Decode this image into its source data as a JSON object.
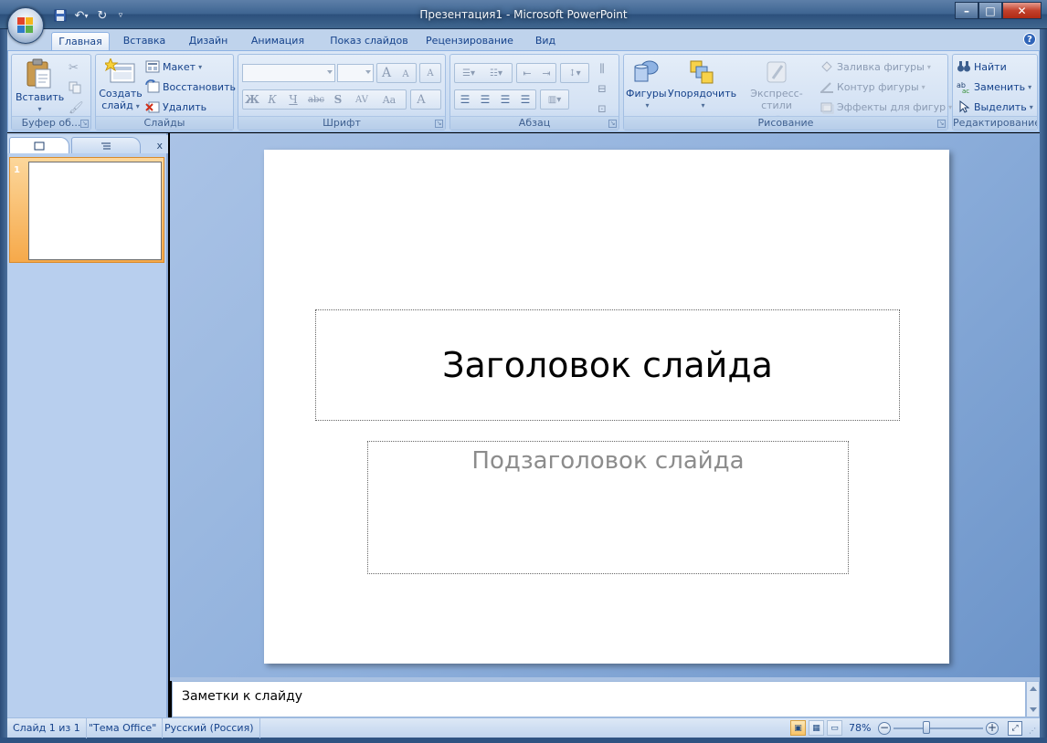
{
  "window": {
    "title": "Презентация1 - Microsoft PowerPoint",
    "controls": {
      "minimize": "–",
      "maximize": "□",
      "close": "✕"
    }
  },
  "qat": {
    "save_icon": "save-icon",
    "undo_icon": "undo-icon",
    "redo_icon": "redo-icon",
    "customize_icon": "customize-icon"
  },
  "tabs": [
    {
      "label": "Главная",
      "active": true
    },
    {
      "label": "Вставка"
    },
    {
      "label": "Дизайн"
    },
    {
      "label": "Анимация"
    },
    {
      "label": "Показ слайдов"
    },
    {
      "label": "Рецензирование"
    },
    {
      "label": "Вид"
    }
  ],
  "ribbon": {
    "clipboard": {
      "label": "Буфер об...",
      "paste": "Вставить"
    },
    "slides": {
      "label": "Слайды",
      "new_slide": "Создать слайд",
      "layout": "Макет",
      "reset": "Восстановить",
      "delete": "Удалить"
    },
    "font": {
      "label": "Шрифт",
      "grow": "A",
      "shrink": "A",
      "clear": "A",
      "bold": "Ж",
      "italic": "К",
      "underline": "Ч",
      "strike": "abc",
      "shadow": "S",
      "spacing": "AV",
      "case": "Aa",
      "color": "A"
    },
    "paragraph": {
      "label": "Абзац"
    },
    "drawing": {
      "label": "Рисование",
      "shapes": "Фигуры",
      "arrange": "Упорядочить",
      "quick_styles": "Экспресс-стили",
      "fill": "Заливка фигуры",
      "outline": "Контур фигуры",
      "effects": "Эффекты для фигур"
    },
    "editing": {
      "label": "Редактирование",
      "find": "Найти",
      "replace": "Заменить",
      "select": "Выделить"
    }
  },
  "slides_panel": {
    "close": "x",
    "thumb_number": "1"
  },
  "slide": {
    "title": "Заголовок слайда",
    "subtitle": "Подзаголовок слайда"
  },
  "notes": {
    "text": "Заметки к слайду"
  },
  "status": {
    "slide_counter": "Слайд 1 из 1",
    "theme": "\"Тема Office\"",
    "language": "Русский (Россия)",
    "zoom": "78%",
    "zoom_minus": "−",
    "zoom_plus": "+"
  },
  "colors": {
    "accent": "#15428b",
    "ribbon": "#c9dbf1",
    "thumb_selected": "#f6a94a"
  }
}
